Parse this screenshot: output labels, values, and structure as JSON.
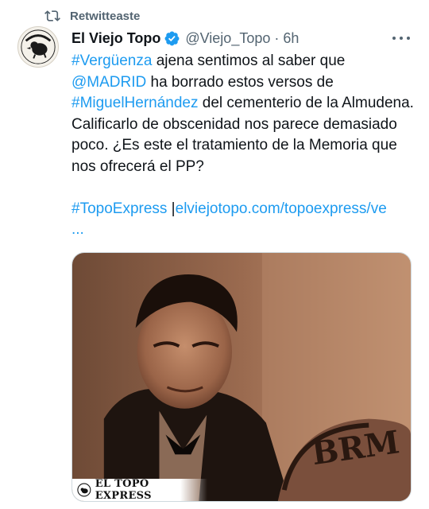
{
  "retweet": {
    "label": "Retwitteaste",
    "icon": "retweet-icon"
  },
  "author": {
    "name": "El Viejo Topo",
    "handle": "@Viejo_Topo",
    "separator": "·",
    "time": "6h",
    "verified": true,
    "avatar_text": "EL VIEJO TOPO"
  },
  "tweet": {
    "seg1": "#Vergüenza",
    "seg2": " ajena sentimos al saber que",
    "seg3": "@MADRID",
    "seg4": " ha borrado estos versos de",
    "seg5": "#MiguelHernández",
    "seg6": " del cementerio de la Almudena. Calificarlo de obscenidad nos parece demasiado poco. ¿Es este el tratamiento de la Memoria que nos ofrecerá el PP?",
    "hashtag2": "#TopoExpress",
    "pipe": " |",
    "url": "elviejotopo.com/topoexpress/ve",
    "ellipsis": "..."
  },
  "media": {
    "brand": "EL TOPO EXPRESS",
    "overlay_letters": "BRM"
  },
  "colors": {
    "link": "#1d9bf0",
    "muted": "#536471",
    "text": "#0f1419"
  }
}
